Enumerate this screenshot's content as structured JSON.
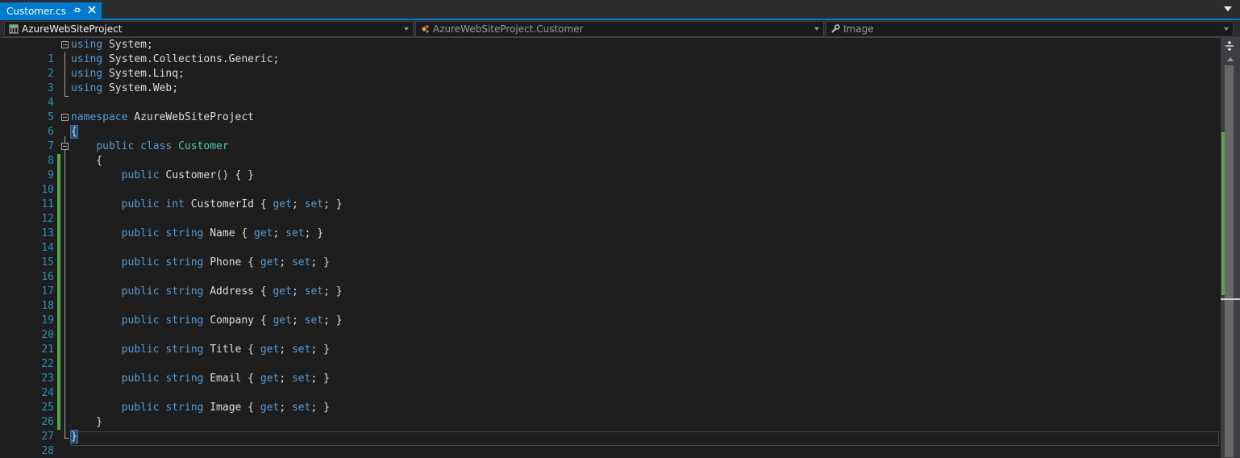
{
  "tab": {
    "title": "Customer.cs",
    "pin_icon": "pin-icon",
    "close_icon": "close-icon"
  },
  "navbar": {
    "project": "AzureWebSiteProject",
    "type": "AzureWebSiteProject.Customer",
    "member": "Image"
  },
  "editor": {
    "lines": [
      {
        "n": "1"
      },
      {
        "n": "2"
      },
      {
        "n": "3"
      },
      {
        "n": "4"
      },
      {
        "n": "5"
      },
      {
        "n": "6"
      },
      {
        "n": "7"
      },
      {
        "n": "8"
      },
      {
        "n": "9"
      },
      {
        "n": "10"
      },
      {
        "n": "11"
      },
      {
        "n": "12"
      },
      {
        "n": "13"
      },
      {
        "n": "14"
      },
      {
        "n": "15"
      },
      {
        "n": "16"
      },
      {
        "n": "17"
      },
      {
        "n": "18"
      },
      {
        "n": "19"
      },
      {
        "n": "20"
      },
      {
        "n": "21"
      },
      {
        "n": "22"
      },
      {
        "n": "23"
      },
      {
        "n": "24"
      },
      {
        "n": "25"
      },
      {
        "n": "26"
      },
      {
        "n": "27"
      },
      {
        "n": "28"
      }
    ],
    "code": {
      "l1_kw": "using",
      "l1_rest": " System;",
      "l2_kw": "using",
      "l2_rest": " System.Collections.Generic;",
      "l3_kw": "using",
      "l3_rest": " System.Linq;",
      "l4_kw": "using",
      "l4_rest": " System.Web;",
      "l6_kw": "namespace",
      "l6_rest": " AzureWebSiteProject",
      "l7": "{",
      "l8_indent": "    ",
      "l8_kw1": "public",
      "l8_kw2": "class",
      "l8_type": "Customer",
      "l9": "    {",
      "l10_kw": "public",
      "l10_rest": " Customer() { }",
      "l12_kw1": "public",
      "l12_kw2": "int",
      "l12_name": " CustomerId { ",
      "l12_get": "get",
      "l12_set": "set",
      "l14_kw1": "public",
      "l14_kw2": "string",
      "l14_name": " Name { ",
      "l14_get": "get",
      "l14_set": "set",
      "l16_kw1": "public",
      "l16_kw2": "string",
      "l16_name": " Phone { ",
      "l16_get": "get",
      "l16_set": "set",
      "l18_kw1": "public",
      "l18_kw2": "string",
      "l18_name": " Address { ",
      "l18_get": "get",
      "l18_set": "set",
      "l20_kw1": "public",
      "l20_kw2": "string",
      "l20_name": " Company { ",
      "l20_get": "get",
      "l20_set": "set",
      "l22_kw1": "public",
      "l22_kw2": "string",
      "l22_name": " Title { ",
      "l22_get": "get",
      "l22_set": "set",
      "l24_kw1": "public",
      "l24_kw2": "string",
      "l24_name": " Email { ",
      "l24_get": "get",
      "l24_set": "set",
      "l26_kw1": "public",
      "l26_kw2": "string",
      "l26_name": " Image { ",
      "l26_get": "get",
      "l26_set": "set",
      "l27": "    }",
      "l28": "}"
    }
  },
  "colors": {
    "accent": "#007acc",
    "keyword": "#569cd6",
    "type": "#4ec9b0",
    "line_number": "#2b91af",
    "change_bar": "#57a64a",
    "background": "#1e1e1e"
  }
}
